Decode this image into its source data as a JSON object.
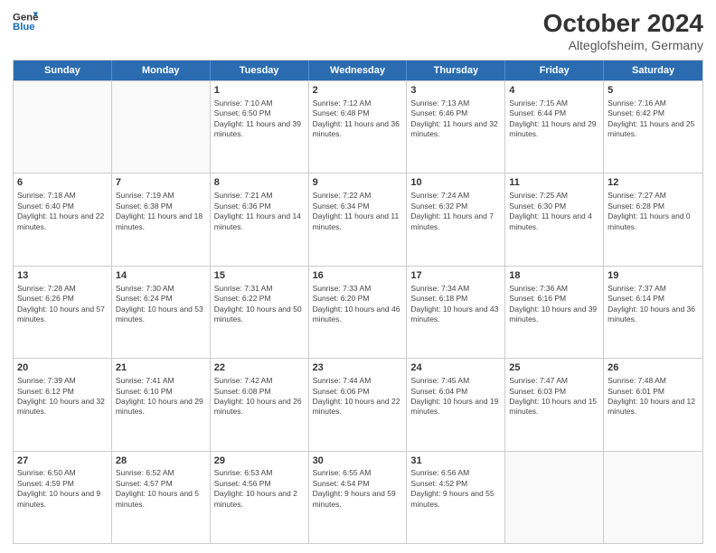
{
  "header": {
    "logo_line1": "General",
    "logo_line2": "Blue",
    "title": "October 2024",
    "location": "Alteglofsheim, Germany"
  },
  "days": [
    "Sunday",
    "Monday",
    "Tuesday",
    "Wednesday",
    "Thursday",
    "Friday",
    "Saturday"
  ],
  "rows": [
    [
      {
        "day": "",
        "info": "",
        "empty": true
      },
      {
        "day": "",
        "info": "",
        "empty": true
      },
      {
        "day": "1",
        "info": "Sunrise: 7:10 AM\nSunset: 6:50 PM\nDaylight: 11 hours and 39 minutes."
      },
      {
        "day": "2",
        "info": "Sunrise: 7:12 AM\nSunset: 6:48 PM\nDaylight: 11 hours and 36 minutes."
      },
      {
        "day": "3",
        "info": "Sunrise: 7:13 AM\nSunset: 6:46 PM\nDaylight: 11 hours and 32 minutes."
      },
      {
        "day": "4",
        "info": "Sunrise: 7:15 AM\nSunset: 6:44 PM\nDaylight: 11 hours and 29 minutes."
      },
      {
        "day": "5",
        "info": "Sunrise: 7:16 AM\nSunset: 6:42 PM\nDaylight: 11 hours and 25 minutes."
      }
    ],
    [
      {
        "day": "6",
        "info": "Sunrise: 7:18 AM\nSunset: 6:40 PM\nDaylight: 11 hours and 22 minutes."
      },
      {
        "day": "7",
        "info": "Sunrise: 7:19 AM\nSunset: 6:38 PM\nDaylight: 11 hours and 18 minutes."
      },
      {
        "day": "8",
        "info": "Sunrise: 7:21 AM\nSunset: 6:36 PM\nDaylight: 11 hours and 14 minutes."
      },
      {
        "day": "9",
        "info": "Sunrise: 7:22 AM\nSunset: 6:34 PM\nDaylight: 11 hours and 11 minutes."
      },
      {
        "day": "10",
        "info": "Sunrise: 7:24 AM\nSunset: 6:32 PM\nDaylight: 11 hours and 7 minutes."
      },
      {
        "day": "11",
        "info": "Sunrise: 7:25 AM\nSunset: 6:30 PM\nDaylight: 11 hours and 4 minutes."
      },
      {
        "day": "12",
        "info": "Sunrise: 7:27 AM\nSunset: 6:28 PM\nDaylight: 11 hours and 0 minutes."
      }
    ],
    [
      {
        "day": "13",
        "info": "Sunrise: 7:28 AM\nSunset: 6:26 PM\nDaylight: 10 hours and 57 minutes."
      },
      {
        "day": "14",
        "info": "Sunrise: 7:30 AM\nSunset: 6:24 PM\nDaylight: 10 hours and 53 minutes."
      },
      {
        "day": "15",
        "info": "Sunrise: 7:31 AM\nSunset: 6:22 PM\nDaylight: 10 hours and 50 minutes."
      },
      {
        "day": "16",
        "info": "Sunrise: 7:33 AM\nSunset: 6:20 PM\nDaylight: 10 hours and 46 minutes."
      },
      {
        "day": "17",
        "info": "Sunrise: 7:34 AM\nSunset: 6:18 PM\nDaylight: 10 hours and 43 minutes."
      },
      {
        "day": "18",
        "info": "Sunrise: 7:36 AM\nSunset: 6:16 PM\nDaylight: 10 hours and 39 minutes."
      },
      {
        "day": "19",
        "info": "Sunrise: 7:37 AM\nSunset: 6:14 PM\nDaylight: 10 hours and 36 minutes."
      }
    ],
    [
      {
        "day": "20",
        "info": "Sunrise: 7:39 AM\nSunset: 6:12 PM\nDaylight: 10 hours and 32 minutes."
      },
      {
        "day": "21",
        "info": "Sunrise: 7:41 AM\nSunset: 6:10 PM\nDaylight: 10 hours and 29 minutes."
      },
      {
        "day": "22",
        "info": "Sunrise: 7:42 AM\nSunset: 6:08 PM\nDaylight: 10 hours and 26 minutes."
      },
      {
        "day": "23",
        "info": "Sunrise: 7:44 AM\nSunset: 6:06 PM\nDaylight: 10 hours and 22 minutes."
      },
      {
        "day": "24",
        "info": "Sunrise: 7:45 AM\nSunset: 6:04 PM\nDaylight: 10 hours and 19 minutes."
      },
      {
        "day": "25",
        "info": "Sunrise: 7:47 AM\nSunset: 6:03 PM\nDaylight: 10 hours and 15 minutes."
      },
      {
        "day": "26",
        "info": "Sunrise: 7:48 AM\nSunset: 6:01 PM\nDaylight: 10 hours and 12 minutes."
      }
    ],
    [
      {
        "day": "27",
        "info": "Sunrise: 6:50 AM\nSunset: 4:59 PM\nDaylight: 10 hours and 9 minutes."
      },
      {
        "day": "28",
        "info": "Sunrise: 6:52 AM\nSunset: 4:57 PM\nDaylight: 10 hours and 5 minutes."
      },
      {
        "day": "29",
        "info": "Sunrise: 6:53 AM\nSunset: 4:56 PM\nDaylight: 10 hours and 2 minutes."
      },
      {
        "day": "30",
        "info": "Sunrise: 6:55 AM\nSunset: 4:54 PM\nDaylight: 9 hours and 59 minutes."
      },
      {
        "day": "31",
        "info": "Sunrise: 6:56 AM\nSunset: 4:52 PM\nDaylight: 9 hours and 55 minutes."
      },
      {
        "day": "",
        "info": "",
        "empty": true
      },
      {
        "day": "",
        "info": "",
        "empty": true
      }
    ]
  ]
}
